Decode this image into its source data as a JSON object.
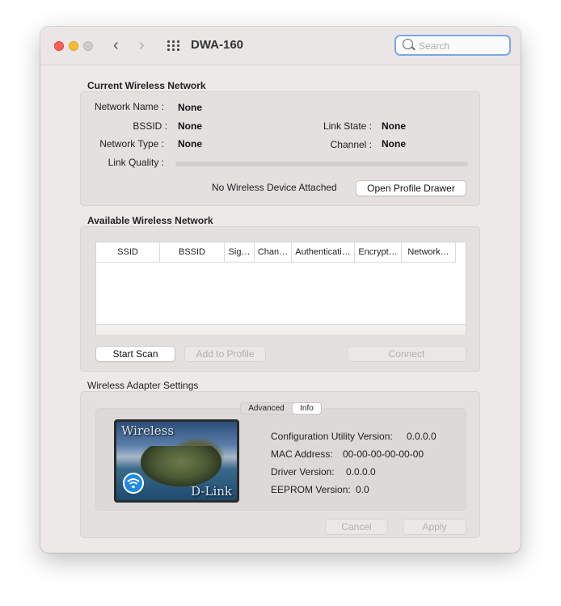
{
  "window": {
    "title": "DWA-160"
  },
  "search": {
    "placeholder": "Search"
  },
  "current": {
    "section_title": "Current Wireless Network",
    "network_name_label": "Network Name :",
    "network_name": "None",
    "bssid_label": "BSSID :",
    "bssid": "None",
    "link_state_label": "Link State :",
    "link_state": "None",
    "network_type_label": "Network Type :",
    "network_type": "None",
    "channel_label": "Channel :",
    "channel": "None",
    "link_quality_label": "Link Quality :",
    "link_quality_percent": 0,
    "status_text": "No Wireless Device Attached",
    "open_profile_drawer": "Open Profile Drawer"
  },
  "available": {
    "section_title": "Available Wireless Network",
    "columns": [
      "SSID",
      "BSSID",
      "Sig…",
      "Chan…",
      "Authenticati…",
      "Encrypt…",
      "Network…"
    ],
    "start_scan": "Start Scan",
    "add_to_profile": "Add to Profile",
    "connect": "Connect"
  },
  "adapter": {
    "section_title": "Wireless Adapter Settings",
    "tabs": [
      "Advanced",
      "Info"
    ],
    "selected_tab": "Info",
    "image_text_top": "Wireless",
    "image_text_bottom": "D-Link",
    "config_version_label": "Configuration Utility Version:",
    "config_version": "0.0.0.0",
    "mac_label": "MAC Address:",
    "mac": "00-00-00-00-00-00",
    "driver_label": "Driver Version:",
    "driver": "0.0.0.0",
    "eeprom_label": "EEPROM Version:",
    "eeprom": "0.0",
    "cancel": "Cancel",
    "apply": "Apply"
  },
  "colors": {
    "accent": "#3478f6",
    "close": "#fe5f57",
    "minimize": "#febc2e",
    "window_bg": "#ece9e8"
  }
}
